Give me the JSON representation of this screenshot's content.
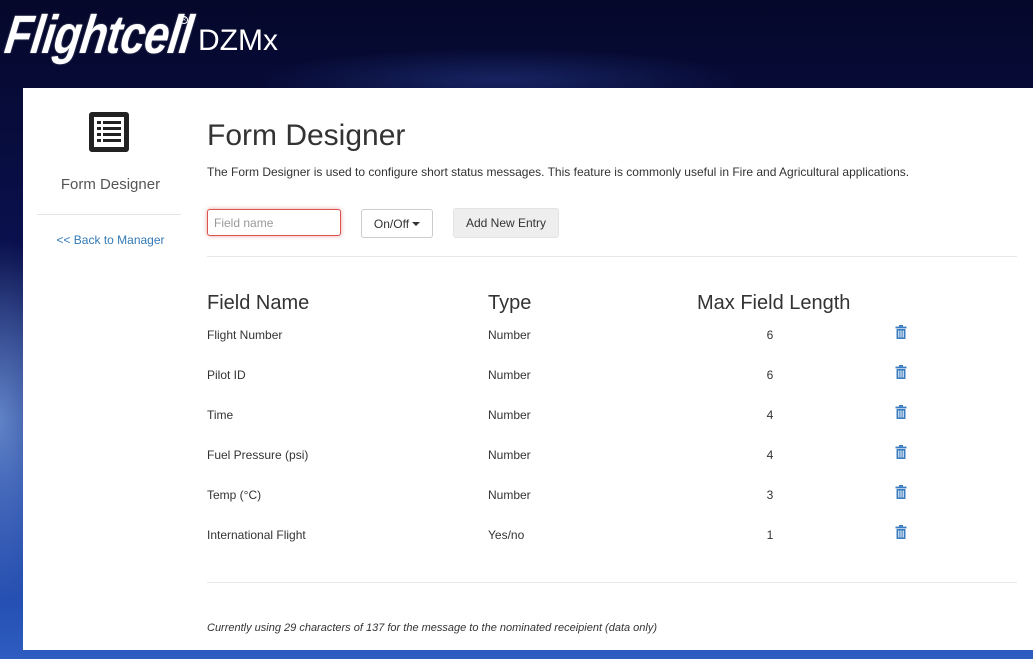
{
  "header": {
    "logo_text": "Flightcell",
    "product_name": "DZMx"
  },
  "sidebar": {
    "icon": "form-list-icon",
    "title": "Form Designer",
    "back_link": "<< Back to Manager"
  },
  "main": {
    "title": "Form Designer",
    "description": "The Form Designer is used to configure short status messages. This feature is commonly useful in Fire and Agricultural applications.",
    "field_input_placeholder": "Field name",
    "type_dropdown_label": "On/Off",
    "add_button_label": "Add New Entry"
  },
  "table": {
    "headers": {
      "field_name": "Field Name",
      "type": "Type",
      "max_length": "Max Field Length"
    },
    "rows": [
      {
        "field_name": "Flight Number",
        "type": "Number",
        "max_length": "6"
      },
      {
        "field_name": "Pilot ID",
        "type": "Number",
        "max_length": "6"
      },
      {
        "field_name": "Time",
        "type": "Number",
        "max_length": "4"
      },
      {
        "field_name": "Fuel Pressure (psi)",
        "type": "Number",
        "max_length": "4"
      },
      {
        "field_name": "Temp (°C)",
        "type": "Number",
        "max_length": "3"
      },
      {
        "field_name": "International Flight",
        "type": "Yes/no",
        "max_length": "1"
      }
    ],
    "delete_icon": "trash-icon"
  },
  "footer_note": "Currently using 29 characters of 137 for the message to the nominated receipient (data only)",
  "colors": {
    "link": "#337ab7",
    "trash": "#3a7cc0",
    "input_error_border": "#d9534f"
  }
}
